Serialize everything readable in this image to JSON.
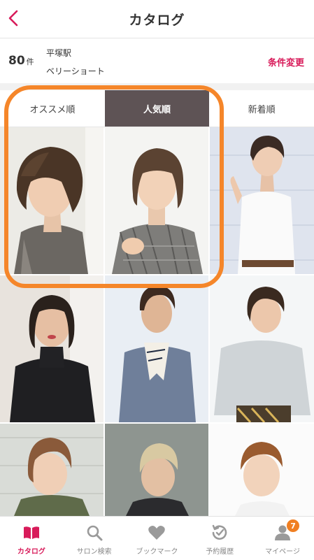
{
  "header": {
    "title": "カタログ",
    "back_icon": "chevron-left-icon"
  },
  "conditions": {
    "count": "80",
    "count_unit": "件",
    "station": "平塚駅",
    "length": "ベリーショート",
    "change_label": "条件変更"
  },
  "sort_tabs": [
    {
      "label": "オススメ順",
      "active": false
    },
    {
      "label": "人気順",
      "active": true
    },
    {
      "label": "新着順",
      "active": false
    }
  ],
  "photos": [
    {
      "kind": "profile-short-brown-hair"
    },
    {
      "kind": "short-hair-plaid-shirt"
    },
    {
      "kind": "pixie-white-tee"
    },
    {
      "kind": "bob-black-turtleneck"
    },
    {
      "kind": "pixie-scarf-sweater"
    },
    {
      "kind": "pixie-grey-sweater"
    },
    {
      "kind": "pixie-brown-light"
    },
    {
      "kind": "blonde-short-dark-top"
    },
    {
      "kind": "pixie-white-background"
    }
  ],
  "tabbar": {
    "items": [
      {
        "label": "カタログ",
        "icon": "book-icon",
        "active": true
      },
      {
        "label": "サロン検索",
        "icon": "search-icon",
        "active": false
      },
      {
        "label": "ブックマーク",
        "icon": "heart-icon",
        "active": false
      },
      {
        "label": "予約履歴",
        "icon": "history-clock-icon",
        "active": false
      },
      {
        "label": "マイページ",
        "icon": "user-icon",
        "active": false,
        "badge": "7"
      }
    ]
  },
  "colors": {
    "accent": "#d81b5a",
    "active_tab_bg": "#5e5355",
    "annotation": "#f5862a",
    "badge": "#f07f22"
  }
}
